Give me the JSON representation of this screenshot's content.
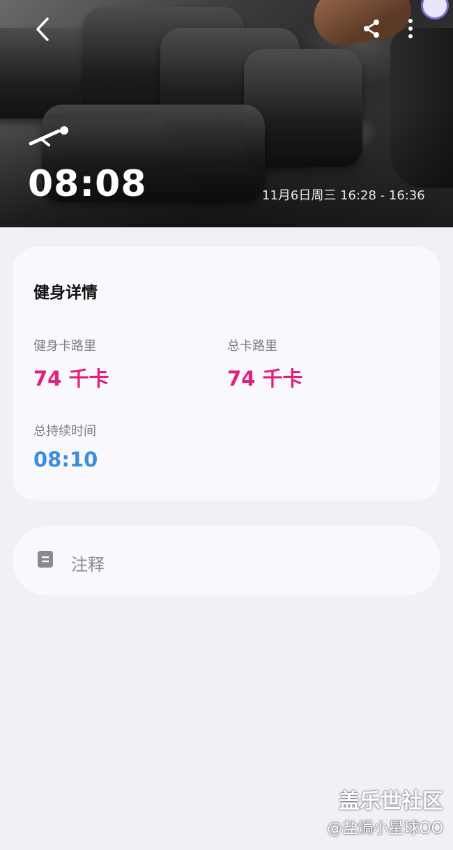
{
  "header": {
    "duration": "08:08",
    "date_range": "11月6日周三 16:28 - 16:36",
    "icons": {
      "back": "chevron-left-icon",
      "share": "share-icon",
      "more": "more-vertical-icon",
      "workout": "workout-pose-icon"
    }
  },
  "details": {
    "title": "健身详情",
    "stats": [
      {
        "label": "健身卡路里",
        "value": "74 千卡",
        "color": "#e0207a"
      },
      {
        "label": "总卡路里",
        "value": "74 千卡",
        "color": "#e0207a"
      },
      {
        "label": "总持续时间",
        "value": "08:10",
        "color": "#3a8ee0"
      }
    ]
  },
  "notes": {
    "label": "注释",
    "icon": "note-icon"
  },
  "watermark": {
    "line1": "盖乐世社区",
    "line2": "@盐焗小星球OO"
  }
}
